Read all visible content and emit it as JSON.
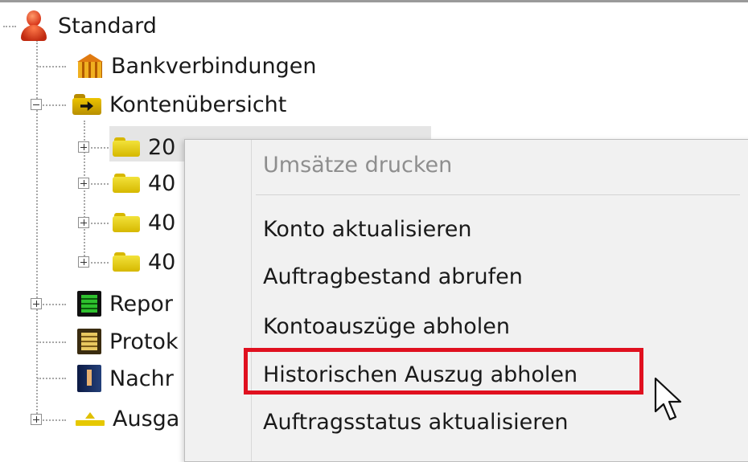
{
  "tree": {
    "root": {
      "label": "Standard",
      "icon": "person-icon"
    },
    "bank": {
      "label": "Bankverbindungen",
      "icon": "bank-icon"
    },
    "accounts": {
      "label": "Kontenübersicht",
      "icon": "folder-arrow-icon",
      "children": [
        {
          "label": "20"
        },
        {
          "label": "40"
        },
        {
          "label": "40"
        },
        {
          "label": "40"
        }
      ]
    },
    "reports": {
      "label": "Repor",
      "icon": "report-icon"
    },
    "protocol": {
      "label": "Protok",
      "icon": "protocol-icon"
    },
    "messages": {
      "label": "Nachr",
      "icon": "book-icon"
    },
    "outbox": {
      "label": "Ausga",
      "icon": "tray-icon"
    }
  },
  "context_menu": {
    "items": [
      {
        "label": "Umsätze drucken",
        "enabled": false
      },
      {
        "label": "Konto aktualisieren",
        "enabled": true
      },
      {
        "label": "Auftragbestand abrufen",
        "enabled": true
      },
      {
        "label": "Kontoauszüge abholen",
        "enabled": true
      },
      {
        "label": "Historischen Auszug abholen",
        "enabled": true,
        "highlighted": true
      },
      {
        "label": "Auftragsstatus aktualisieren",
        "enabled": true
      }
    ],
    "highlight_color": "#e0101f"
  }
}
